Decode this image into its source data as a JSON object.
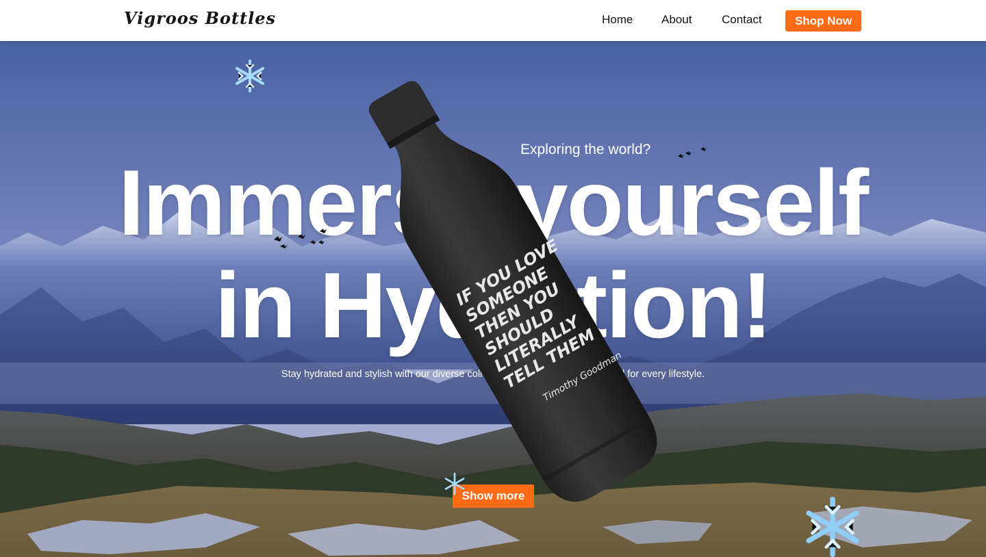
{
  "brand": {
    "logo_text": "Vigroos Bottles"
  },
  "nav": {
    "items": [
      {
        "label": "Home"
      },
      {
        "label": "About"
      },
      {
        "label": "Contact"
      }
    ],
    "cta_label": "Shop Now"
  },
  "hero": {
    "eyebrow": "Exploring the world?",
    "headline_line1": "Immerse yourself",
    "headline_line2": "in Hydration!",
    "tagline": "Stay hydrated and stylish with our diverse collection of water bottles, designed for every lifestyle.",
    "button_label": "Show more"
  },
  "bottle_print": {
    "quote_lines": [
      "IF YOU LOVE",
      "SOMEONE",
      "THEN YOU",
      "SHOULD",
      "LITERALLY",
      "TELL THEM"
    ],
    "signature": "Timothy Goodman"
  },
  "colors": {
    "accent": "#ff6b15",
    "header_bg": "#ffffff",
    "bottle": "#2b2b2b",
    "sky_top": "#4f66a6",
    "sky_bottom": "#9aa6cc"
  },
  "icons": [
    "snowflake-icon",
    "bird-icon"
  ]
}
